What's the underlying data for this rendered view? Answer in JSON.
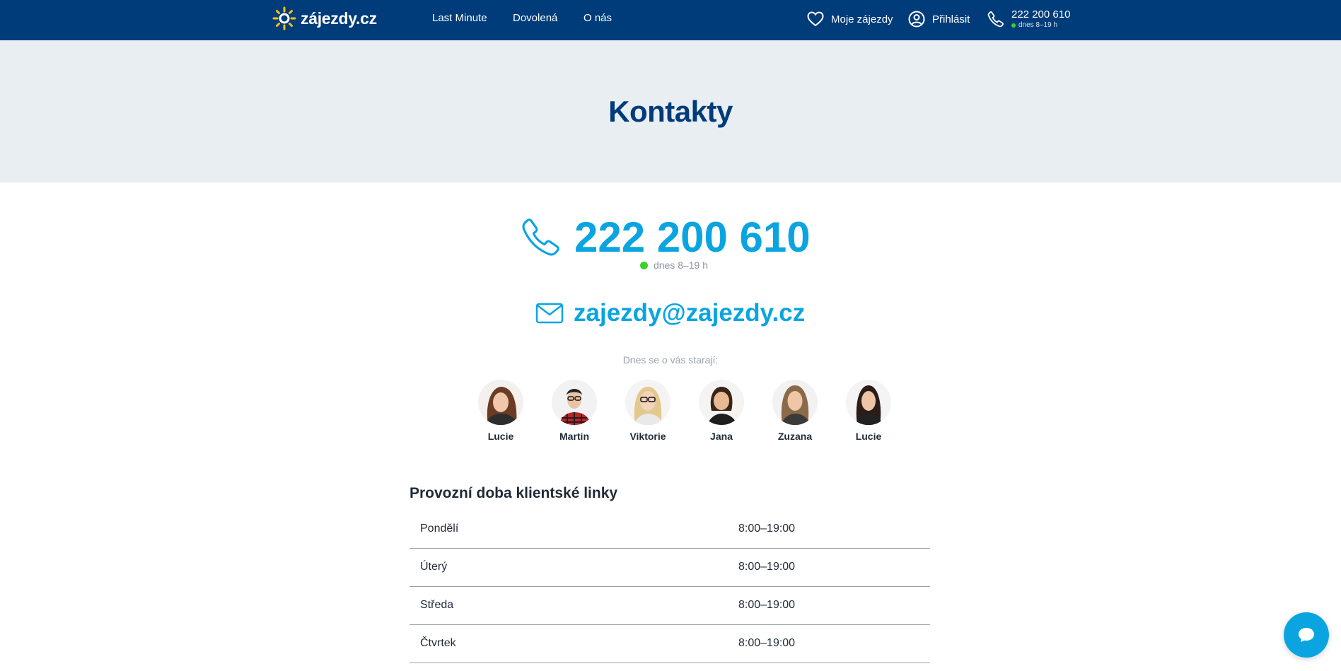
{
  "header": {
    "logo_text": "zájezdy.cz",
    "nav": [
      {
        "label": "Last Minute"
      },
      {
        "label": "Dovolená"
      },
      {
        "label": "O nás"
      }
    ],
    "my_trips": "Moje zájezdy",
    "login": "Přihlásit",
    "phone": "222 200 610",
    "phone_hours": "dnes 8–19 h"
  },
  "hero": {
    "title": "Kontakty"
  },
  "contact": {
    "phone": "222 200 610",
    "hours": "dnes 8–19 h",
    "email": "zajezdy@zajezdy.cz",
    "care_label": "Dnes se o vás starají:",
    "team": [
      {
        "name": "Lucie"
      },
      {
        "name": "Martin"
      },
      {
        "name": "Viktorie"
      },
      {
        "name": "Jana"
      },
      {
        "name": "Zuzana"
      },
      {
        "name": "Lucie"
      }
    ]
  },
  "schedule": {
    "title": "Provozní doba klientské linky",
    "rows": [
      {
        "day": "Pondělí",
        "time": "8:00–19:00"
      },
      {
        "day": "Úterý",
        "time": "8:00–19:00"
      },
      {
        "day": "Středa",
        "time": "8:00–19:00"
      },
      {
        "day": "Čtvrtek",
        "time": "8:00–19:00"
      }
    ]
  },
  "colors": {
    "header_bg": "#003c7a",
    "accent": "#0aa5e1",
    "hero_bg": "#e9eef3",
    "online": "#3bd12a"
  },
  "icons": {
    "logo": "sun-icon",
    "my_trips": "heart-icon",
    "login": "user-icon",
    "phone": "phone-icon",
    "email": "envelope-icon",
    "chat": "chat-bubble-icon"
  }
}
